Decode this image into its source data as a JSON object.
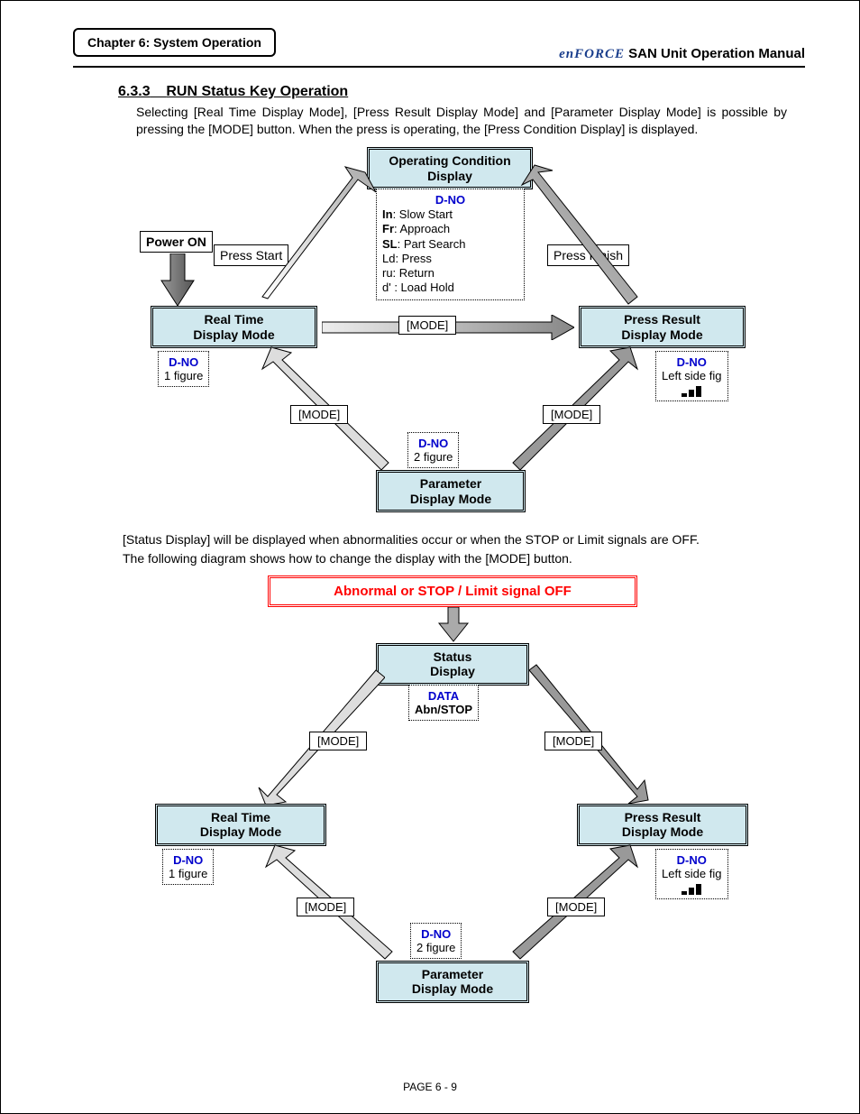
{
  "header": {
    "chapter": "Chapter 6: System Operation",
    "brand": "enFORCE",
    "product": "SAN  Unit  Operation  Manual"
  },
  "section": {
    "num": "6.3.3",
    "title": "RUN Status Key Operation"
  },
  "para1": "Selecting [Real Time Display Mode], [Press Result Display Mode] and [Parameter Display Mode] is possible by pressing the [MODE] button. When the press is operating, the [Press Condition Display] is displayed.",
  "dia1": {
    "power_on": "Power ON",
    "op_cond_l1": "Operating Condition",
    "op_cond_l2": "Display",
    "press_start": "Press Start",
    "press_finish": "Press Finish",
    "dno_header": "D-NO",
    "dno_lines": [
      "In: Slow Start",
      "Fr: Approach",
      "SL: Part Search",
      "Ld: Press",
      "ru: Return",
      "d' : Load Hold"
    ],
    "realtime_l1": "Real Time",
    "realtime_l2": "Display Mode",
    "pressres_l1": "Press Result",
    "pressres_l2": "Display Mode",
    "param_l1": "Parameter",
    "param_l2": "Display Mode",
    "mode": "[MODE]",
    "dno_rt": "1 figure",
    "dno_pr": "Left side fig",
    "dno_pm": "2 figure"
  },
  "para2": "[Status Display] will be displayed when abnormalities occur or when the STOP or Limit signals are OFF.",
  "para3": "The following diagram shows how to change the display with the [MODE] button.",
  "dia2": {
    "abn": "Abnormal or STOP / Limit signal OFF",
    "status_l1": "Status",
    "status_l2": "Display",
    "data": "DATA",
    "abn_stop": "Abn/STOP",
    "realtime_l1": "Real Time",
    "realtime_l2": "Display Mode",
    "pressres_l1": "Press Result",
    "pressres_l2": "Display Mode",
    "param_l1": "Parameter",
    "param_l2": "Display Mode",
    "mode": "[MODE]",
    "dno": "D-NO",
    "dno_rt": "1 figure",
    "dno_pr": "Left side fig",
    "dno_pm": "2 figure"
  },
  "footer": "PAGE 6 - 9"
}
